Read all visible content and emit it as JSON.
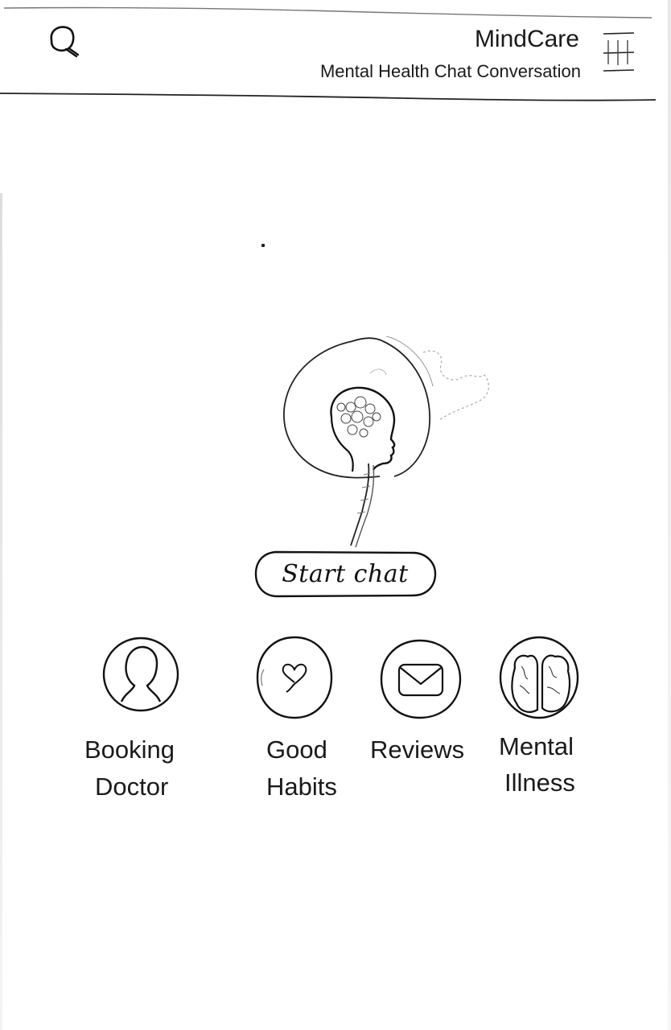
{
  "header": {
    "title": "MindCare",
    "subtitle": "Mental Health Chat Conversation",
    "search_icon": "search-icon",
    "menu_icon": "hamburger-menu-icon"
  },
  "hero": {
    "illustration": "head-brain-illustration",
    "cta_label": "Start chat"
  },
  "features": [
    {
      "line1": "Booking",
      "line2": "Doctor",
      "icon": "doctor-avatar-icon"
    },
    {
      "line1": "Good",
      "line2": "Habits",
      "icon": "heart-icon"
    },
    {
      "line1": "Reviews",
      "line2": "",
      "icon": "mail-icon"
    },
    {
      "line1": "Mental",
      "line2": "Illness",
      "icon": "brain-icon"
    }
  ],
  "colors": {
    "background": "#ffffff",
    "ink": "#1a1a1a"
  }
}
